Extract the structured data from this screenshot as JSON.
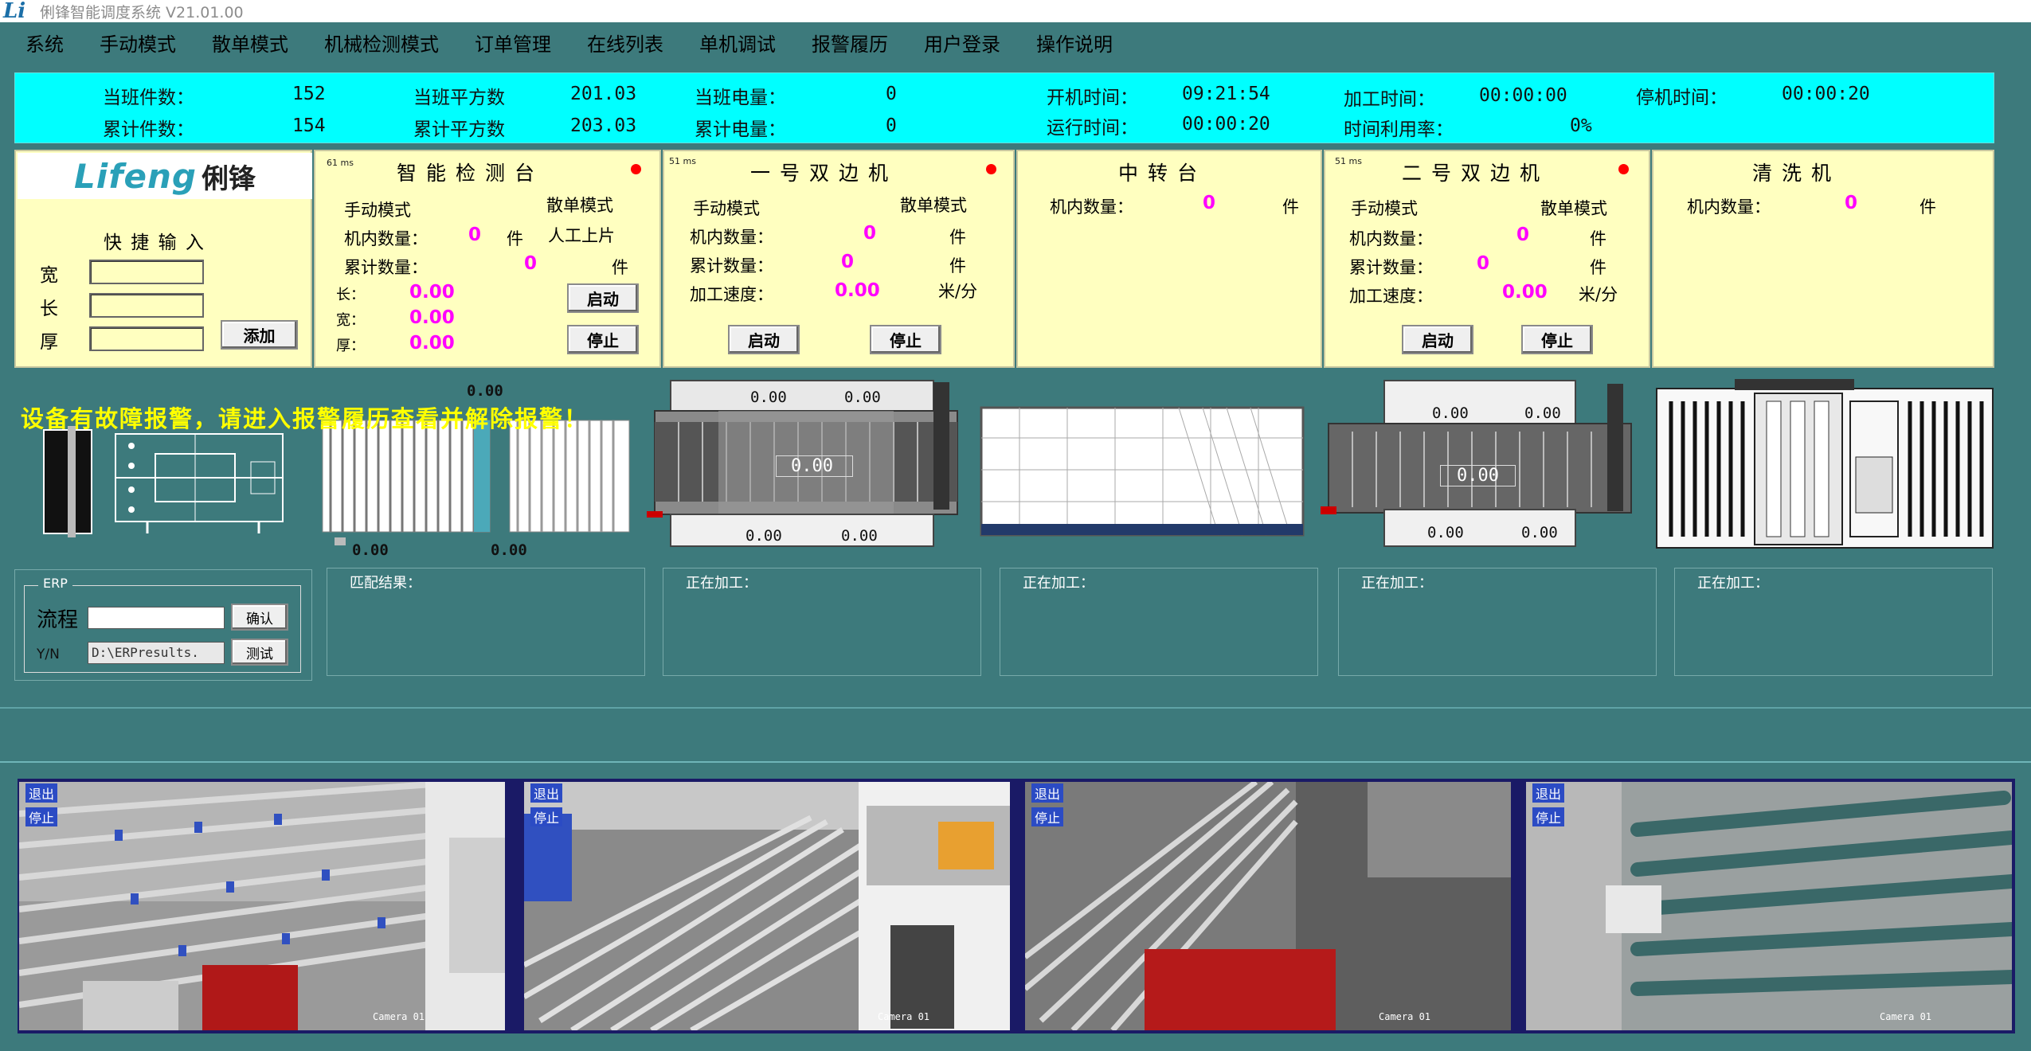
{
  "app": {
    "logo": "Li",
    "title": "俐锋智能调度系统 V21.01.00"
  },
  "menu": [
    "系统",
    "手动模式",
    "散单模式",
    "机械检测模式",
    "订单管理",
    "在线列表",
    "单机调试",
    "报警履历",
    "用户登录",
    "操作说明"
  ],
  "stats": {
    "shift_count_label": "当班件数：",
    "shift_count": "152",
    "total_count_label": "累计件数：",
    "total_count": "154",
    "shift_area_label": "当班平方数",
    "shift_area": "201.03",
    "total_area_label": "累计平方数",
    "total_area": "203.03",
    "shift_power_label": "当班电量：",
    "shift_power": "0",
    "total_power_label": "累计电量：",
    "total_power": "0",
    "start_time_label": "开机时间：",
    "start_time": "09:21:54",
    "run_time_label": "运行时间：",
    "run_time": "00:00:20",
    "process_time_label": "加工时间：",
    "process_time": "00:00:00",
    "util_label": "时间利用率：",
    "util": "0%",
    "stop_time_label": "停机时间：",
    "stop_time": "00:00:20"
  },
  "quick": {
    "brand_en": "Lifeng",
    "brand_cn": "俐锋",
    "title": "快 捷 输 入",
    "width_label": "宽",
    "length_label": "长",
    "thick_label": "厚",
    "add_button": "添加"
  },
  "inspect": {
    "ms": "61 ms",
    "title": "智能检测台",
    "mode_manual": "手动模式",
    "mode_bulk": "散单模式",
    "inner_label": "机内数量：",
    "inner_value": "0",
    "unit": "件",
    "manual_load": "人工上片",
    "total_label": "累计数量：",
    "total_value": "0",
    "len_label": "长：",
    "len_value": "0.00",
    "wid_label": "宽：",
    "wid_value": "0.00",
    "thk_label": "厚：",
    "thk_value": "0.00",
    "start": "启动",
    "stop": "停止"
  },
  "edger1": {
    "ms": "51 ms",
    "title": "一号双边机",
    "mode_manual": "手动模式",
    "mode_bulk": "散单模式",
    "inner_label": "机内数量：",
    "inner_value": "0",
    "unit": "件",
    "total_label": "累计数量：",
    "total_value": "0",
    "speed_label": "加工速度：",
    "speed_value": "0.00",
    "speed_unit": "米/分",
    "start": "启动",
    "stop": "停止"
  },
  "transfer": {
    "title": "中转台",
    "inner_label": "机内数量：",
    "inner_value": "0",
    "unit": "件"
  },
  "edger2": {
    "ms": "51 ms",
    "title": "二号双边机",
    "mode_manual": "手动模式",
    "mode_bulk": "散单模式",
    "inner_label": "机内数量：",
    "inner_value": "0",
    "unit": "件",
    "total_label": "累计数量：",
    "total_value": "0",
    "speed_label": "加工速度：",
    "speed_value": "0.00",
    "speed_unit": "米/分",
    "start": "启动",
    "stop": "停止"
  },
  "washer": {
    "title": "清洗机",
    "inner_label": "机内数量：",
    "inner_value": "0",
    "unit": "件"
  },
  "diagram": {
    "insp_top": "0.00",
    "insp_bl": "0.00",
    "insp_br": "0.00",
    "e1_tl": "0.00",
    "e1_tr": "0.00",
    "e1_mid": "0.00",
    "e1_bl": "0.00",
    "e1_br": "0.00",
    "e2_tl": "0.00",
    "e2_tr": "0.00",
    "e2_mid": "0.00",
    "e2_bl": "0.00",
    "e2_br": "0.00"
  },
  "alarm_text": "设备有故障报警，请进入报警履历查看并解除报警！",
  "erp": {
    "legend": "ERP",
    "label1": "流程",
    "confirm": "确认",
    "label2": "Y/N",
    "path_value": "D:\\ERPresults.",
    "test": "测试"
  },
  "info": {
    "match_label": "匹配结果：",
    "processing1": "正在加工：",
    "processing2": "正在加工：",
    "processing3": "正在加工：",
    "processing4": "正在加工："
  },
  "cameras": [
    {
      "overlay1": "退出",
      "overlay2": "停止",
      "name": "Camera 01"
    },
    {
      "overlay1": "退出",
      "overlay2": "停止",
      "name": "Camera 01"
    },
    {
      "overlay1": "退出",
      "overlay2": "停止",
      "name": "Camera 01"
    },
    {
      "overlay1": "退出",
      "overlay2": "停止",
      "name": "Camera 01"
    }
  ]
}
